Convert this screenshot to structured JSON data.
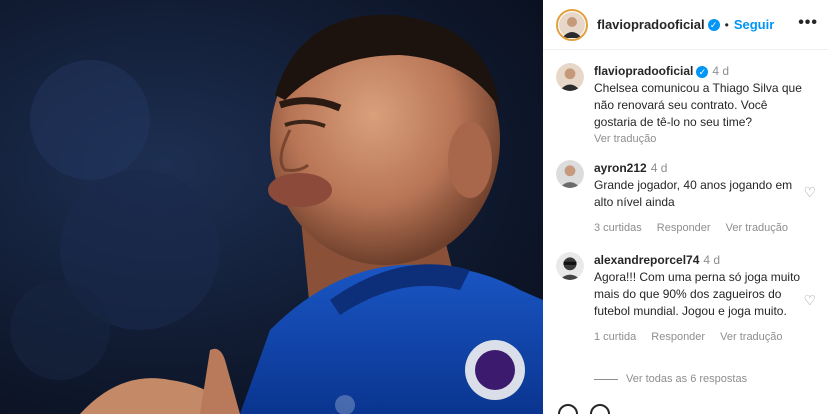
{
  "header": {
    "username": "flaviopradooficial",
    "separator": "•",
    "follow_label": "Seguir",
    "more_label": "•••"
  },
  "caption": {
    "username": "flaviopradooficial",
    "age": "4 d",
    "text": "Chelsea comunicou a Thiago Silva que não renovará seu contrato. Você gostaria de tê-lo no seu time?",
    "translate": "Ver tradução"
  },
  "comments": [
    {
      "username": "ayron212",
      "age": "4 d",
      "text": "Grande jogador, 40 anos jogando em alto nível ainda",
      "likes": "3 curtidas",
      "reply": "Responder",
      "translate": "Ver tradução"
    },
    {
      "username": "alexandreporcel74",
      "age": "4 d",
      "text": "Agora!!! Com uma perna só joga muito mais do que 90% dos zagueiros do futebol mundial. Jogou e joga muito.",
      "likes": "1 curtida",
      "reply": "Responder",
      "translate": "Ver tradução"
    }
  ],
  "view_replies_label": "Ver todas as 6 respostas",
  "icons": {
    "verified": "verified-badge-icon",
    "heart": "heart-icon",
    "more": "more-options-icon"
  },
  "colors": {
    "accent": "#0095f6",
    "muted": "#8e8e8e",
    "text": "#262626",
    "jersey": "#0a3fa8"
  }
}
